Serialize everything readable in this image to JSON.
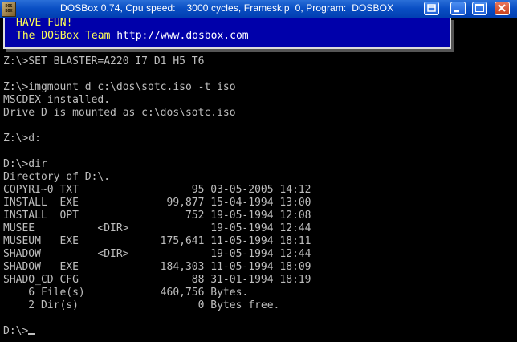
{
  "window": {
    "title": "DOSBox 0.74, Cpu speed:    3000 cycles, Frameskip  0, Program:  DOSBOX",
    "app_icon_text": "DOS BOX",
    "buttons": [
      "special",
      "minimize",
      "maximize",
      "close"
    ]
  },
  "banner": {
    "line1": "HAVE FUN!",
    "line2_prefix": "The DOSBox Team ",
    "line2_url": "http://www.dosbox.com"
  },
  "console": {
    "lines": [
      "Z:\\>SET BLASTER=A220 I7 D1 H5 T6",
      "",
      "Z:\\>imgmount d c:\\dos\\sotc.iso -t iso",
      "MSCDEX installed.",
      "Drive D is mounted as c:\\dos\\sotc.iso",
      "",
      "Z:\\>d:",
      "",
      "D:\\>dir",
      "Directory of D:\\.",
      "COPYRI~0 TXT                  95 03-05-2005 14:12",
      "INSTALL  EXE              99,877 15-04-1994 13:00",
      "INSTALL  OPT                 752 19-05-1994 12:08",
      "MUSEE          <DIR>             19-05-1994 12:44",
      "MUSEUM   EXE             175,641 11-05-1994 18:11",
      "SHADOW         <DIR>             19-05-1994 12:44",
      "SHADOW   EXE             184,303 11-05-1994 18:09",
      "SHADO_CD CFG                  88 31-01-1994 18:19",
      "    6 File(s)            460,756 Bytes.",
      "    2 Dir(s)                   0 Bytes free.",
      ""
    ],
    "prompt": "D:\\>"
  },
  "colors": {
    "titlebar": "#0a4fc4",
    "banner_bg": "#0000aa",
    "banner_text": "#ffff55",
    "console_text": "#bebebe",
    "screen_bg": "#000000"
  }
}
